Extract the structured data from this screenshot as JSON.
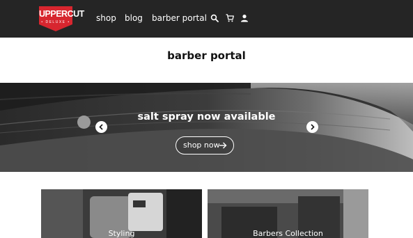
{
  "header": {
    "logo": {
      "main": "UPPERCUT",
      "sub": "• DELUXE •"
    },
    "nav": [
      {
        "label": "shop"
      },
      {
        "label": "blog"
      },
      {
        "label": "barber portal"
      }
    ],
    "icons": [
      "search-icon",
      "cart-icon",
      "account-icon"
    ]
  },
  "page": {
    "title": "barber portal"
  },
  "hero": {
    "headline": "salt spray now available",
    "cta_label": "shop now",
    "controls": [
      "slide-dot",
      "arrow-left-icon",
      "arrow-right-icon"
    ]
  },
  "collections": [
    {
      "label": "Styling"
    },
    {
      "label": "Barbers Collection"
    }
  ],
  "colors": {
    "header_bg": "#252525",
    "brand_red": "#d7262f",
    "page_bg": "#ffffff",
    "hero_overlay": "#3a3a3a"
  }
}
